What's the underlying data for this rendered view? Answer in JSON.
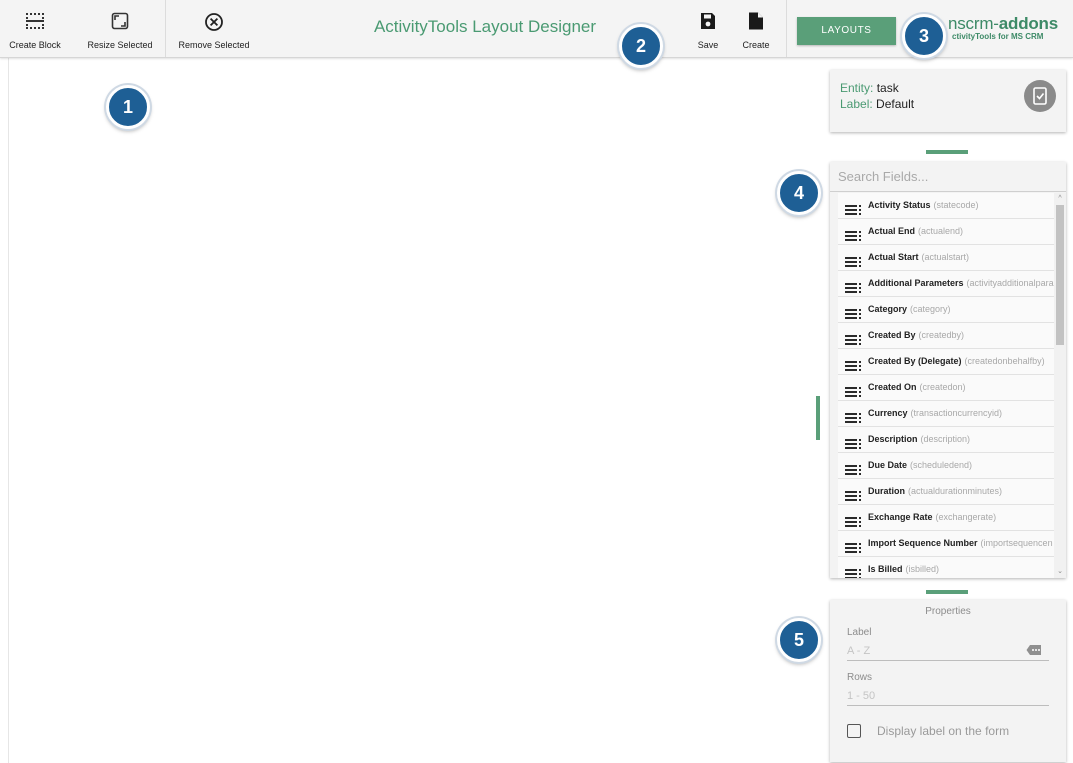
{
  "toolbar": {
    "create_block": "Create Block",
    "resize_selected": "Resize Selected",
    "remove_selected": "Remove Selected",
    "title": "ActivityTools Layout Designer",
    "save": "Save",
    "create": "Create",
    "layouts": "LAYOUTS"
  },
  "brand": {
    "main_prefix": "nscrm-",
    "main_bold": "addons",
    "sub": "ctivityTools for MS CRM"
  },
  "entity": {
    "entity_key": "Entity:",
    "entity_value": "task",
    "label_key": "Label:",
    "label_value": "Default"
  },
  "search": {
    "placeholder": "Search Fields..."
  },
  "fields": [
    {
      "name": "Activity Status",
      "code": "(statecode)"
    },
    {
      "name": "Actual End",
      "code": "(actualend)"
    },
    {
      "name": "Actual Start",
      "code": "(actualstart)"
    },
    {
      "name": "Additional Parameters",
      "code": "(activityadditionalpara"
    },
    {
      "name": "Category",
      "code": "(category)"
    },
    {
      "name": "Created By",
      "code": "(createdby)"
    },
    {
      "name": "Created By (Delegate)",
      "code": "(createdonbehalfby)"
    },
    {
      "name": "Created On",
      "code": "(createdon)"
    },
    {
      "name": "Currency",
      "code": "(transactioncurrencyid)"
    },
    {
      "name": "Description",
      "code": "(description)"
    },
    {
      "name": "Due Date",
      "code": "(scheduledend)"
    },
    {
      "name": "Duration",
      "code": "(actualdurationminutes)"
    },
    {
      "name": "Exchange Rate",
      "code": "(exchangerate)"
    },
    {
      "name": "Import Sequence Number",
      "code": "(importsequencen"
    },
    {
      "name": "Is Billed",
      "code": "(isbilled)"
    }
  ],
  "properties": {
    "title": "Properties",
    "label_caption": "Label",
    "label_placeholder": "A - Z",
    "rows_caption": "Rows",
    "rows_placeholder": "1 - 50",
    "display_label": "Display label on the form",
    "display_label_checked": false
  },
  "callouts": [
    "1",
    "2",
    "3",
    "4",
    "5"
  ],
  "colors": {
    "accent": "#5a9f79",
    "callout": "#1e5f95",
    "toolbar_bg": "#f4f4f4"
  },
  "icons": {
    "create_block": "grid-block-icon",
    "resize": "resize-icon",
    "remove": "close-circle-icon",
    "save": "floppy-disk-icon",
    "create": "new-document-icon",
    "entity": "checkbox-document-icon",
    "field_drag": "drag-handle-icon",
    "label_tag": "tag-icon"
  }
}
